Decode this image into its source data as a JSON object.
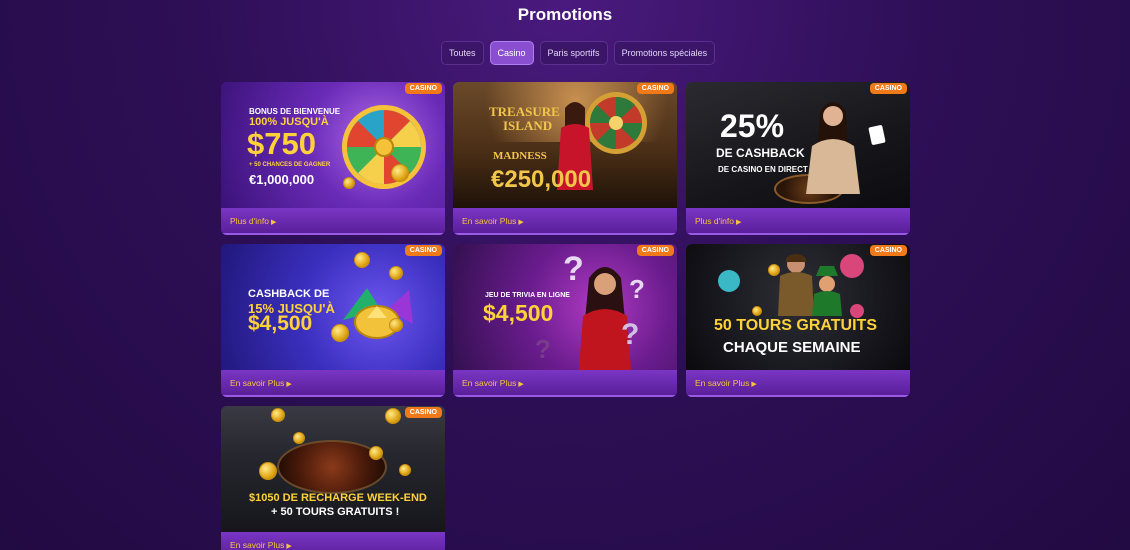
{
  "page": {
    "title": "Promotions"
  },
  "tabs": [
    {
      "label": "Toutes",
      "active": false
    },
    {
      "label": "Casino",
      "active": true
    },
    {
      "label": "Paris sportifs",
      "active": false
    },
    {
      "label": "Promotions spéciales",
      "active": false
    }
  ],
  "cards": [
    {
      "badge": "CASINO",
      "lines": [
        "BONUS DE BIENVENUE",
        "100% JUSQU'À",
        "$750",
        "+ 50 CHANCES DE GAGNER",
        "€1,000,000"
      ],
      "link": "Plus d'info"
    },
    {
      "badge": "CASINO",
      "lines": [
        "TREASURE",
        "ISLAND",
        "MADNESS",
        "€250,000"
      ],
      "link": "En savoir Plus"
    },
    {
      "badge": "CASINO",
      "lines": [
        "25%",
        "DE CASHBACK",
        "DE CASINO EN DIRECT"
      ],
      "link": "Plus d'info"
    },
    {
      "badge": "CASINO",
      "lines": [
        "CASHBACK DE",
        "15% JUSQU'À",
        "$4,500"
      ],
      "link": "En savoir Plus"
    },
    {
      "badge": "CASINO",
      "lines": [
        "JEU DE TRIVIA EN LIGNE",
        "$4,500"
      ],
      "link": "En savoir Plus"
    },
    {
      "badge": "CASINO",
      "lines": [
        "50 TOURS GRATUITS",
        "CHAQUE SEMAINE"
      ],
      "link": "En savoir Plus"
    },
    {
      "badge": "CASINO",
      "lines": [
        "$1050 DE RECHARGE WEEK-END",
        "+ 50 TOURS GRATUITS !"
      ],
      "link": "En savoir Plus"
    }
  ],
  "colors": {
    "background": "#2e0f57",
    "accent": "#8a4fd0",
    "badge": "#f07a1a",
    "link": "#f7c43a"
  }
}
